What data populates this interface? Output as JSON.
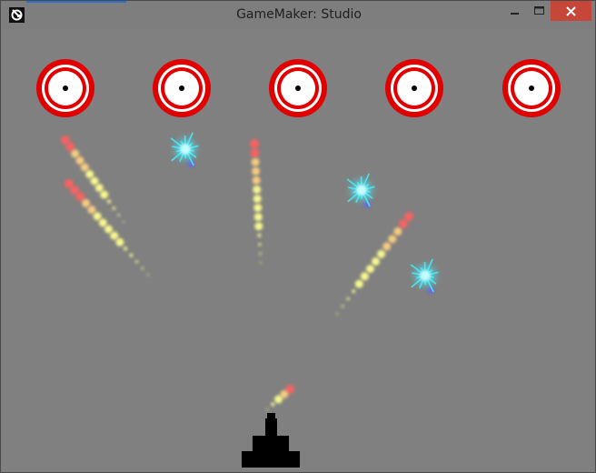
{
  "window": {
    "title": "GameMaker: Studio",
    "controls": {
      "minimize_icon": "minimize-icon",
      "maximize_icon": "maximize-icon",
      "close_icon": "close-icon"
    }
  },
  "game": {
    "background_color": "#808080",
    "targets": {
      "count": 5,
      "outer_color": "#e00000",
      "inner_color": "#ffffff",
      "center_color": "#000000"
    },
    "cannon": {
      "color": "#000000"
    },
    "effects": {
      "firework_trail_colors": [
        "#ff6060",
        "#ffd080",
        "#ffff90"
      ],
      "spark_color": "#40f0ff",
      "spark_shadow_color": "#6060ff"
    }
  }
}
